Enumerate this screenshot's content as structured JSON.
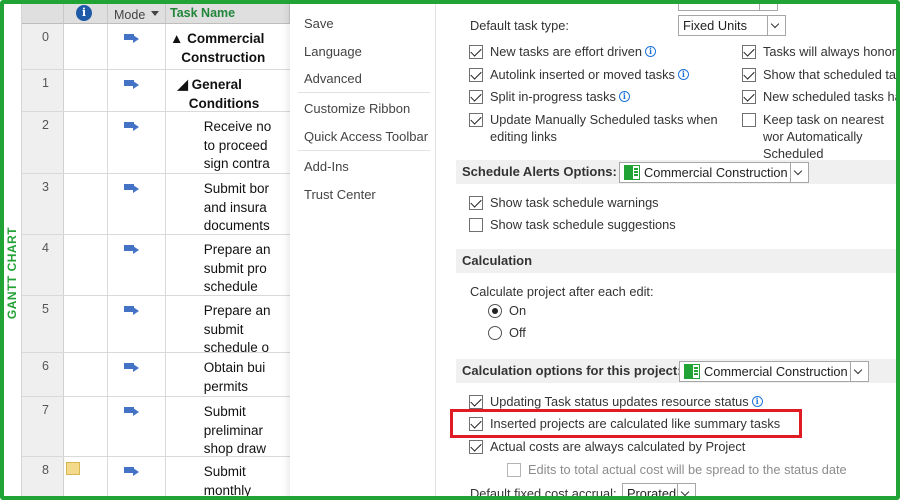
{
  "sidebar_strip": {
    "label": "GANTT CHART"
  },
  "grid": {
    "headers": {
      "info": "i",
      "mode": "Mode",
      "task_name": "Task Name"
    },
    "rows": [
      {
        "id": "0",
        "task": "▲ Commercial\n   Construction",
        "bold": true,
        "note": false
      },
      {
        "id": "1",
        "task": "  ◢ General\n     Conditions",
        "bold": true,
        "note": false
      },
      {
        "id": "2",
        "task": "         Receive no\n         to proceed\n         sign contra",
        "bold": false,
        "note": false
      },
      {
        "id": "3",
        "task": "         Submit bor\n         and insura\n         documents",
        "bold": false,
        "note": false
      },
      {
        "id": "4",
        "task": "         Prepare an\n         submit pro\n         schedule",
        "bold": false,
        "note": false
      },
      {
        "id": "5",
        "task": "         Prepare an\n         submit\n         schedule o",
        "bold": false,
        "note": false
      },
      {
        "id": "6",
        "task": "         Obtain bui\n         permits",
        "bold": false,
        "note": false
      },
      {
        "id": "7",
        "task": "         Submit\n         preliminar\n         shop draw",
        "bold": false,
        "note": false
      },
      {
        "id": "8",
        "task": "         Submit\n         monthly",
        "bold": false,
        "note": true
      }
    ]
  },
  "nav": {
    "items": [
      "Save",
      "Language",
      "Advanced",
      "Customize Ribbon",
      "Quick Access Toolbar",
      "Add-Ins",
      "Trust Center"
    ]
  },
  "content": {
    "default_task_type_label": "Default task type:",
    "default_task_type_value": "Fixed Units",
    "checks_left": [
      {
        "label": "New tasks are effort driven",
        "checked": true,
        "help": true
      },
      {
        "label": "Autolink inserted or moved tasks",
        "checked": true,
        "help": true
      },
      {
        "label": "Split in-progress tasks",
        "checked": true,
        "help": true
      },
      {
        "label": "Update Manually Scheduled tasks when editing links",
        "checked": true,
        "help": false
      }
    ],
    "checks_right": [
      {
        "label": "Tasks will always honor t",
        "checked": true
      },
      {
        "label": "Show that scheduled tas",
        "checked": true
      },
      {
        "label": "New scheduled tasks hav",
        "checked": true
      },
      {
        "label": "Keep task on nearest wor Automatically Scheduled",
        "checked": false
      }
    ],
    "schedule_alerts": {
      "title": "Schedule Alerts Options:",
      "project": "Commercial Construction",
      "items": [
        {
          "label": "Show task schedule warnings",
          "checked": true
        },
        {
          "label": "Show task schedule suggestions",
          "checked": false
        }
      ]
    },
    "calculation": {
      "title": "Calculation",
      "prompt": "Calculate project after each edit:",
      "options": [
        {
          "label": "On",
          "selected": true
        },
        {
          "label": "Off",
          "selected": false
        }
      ]
    },
    "calc_options": {
      "title": "Calculation options for this project:",
      "project": "Commercial Construction",
      "items": [
        {
          "label": "Updating Task status updates resource status",
          "checked": true,
          "help": true,
          "disabled": false
        },
        {
          "label": "Inserted projects are calculated like summary tasks",
          "checked": true,
          "help": false,
          "disabled": false
        },
        {
          "label": "Actual costs are always calculated by Project",
          "checked": true,
          "help": false,
          "disabled": false
        },
        {
          "label": "Edits to total actual cost will be spread to the status date",
          "checked": false,
          "help": false,
          "disabled": true
        }
      ],
      "fixed_cost_label": "Default fixed cost accrual:",
      "fixed_cost_value": "Prorated"
    }
  },
  "colors": {
    "accent": "#21a336",
    "highlight": "#e01b24",
    "task_icon": "#4472c4"
  }
}
